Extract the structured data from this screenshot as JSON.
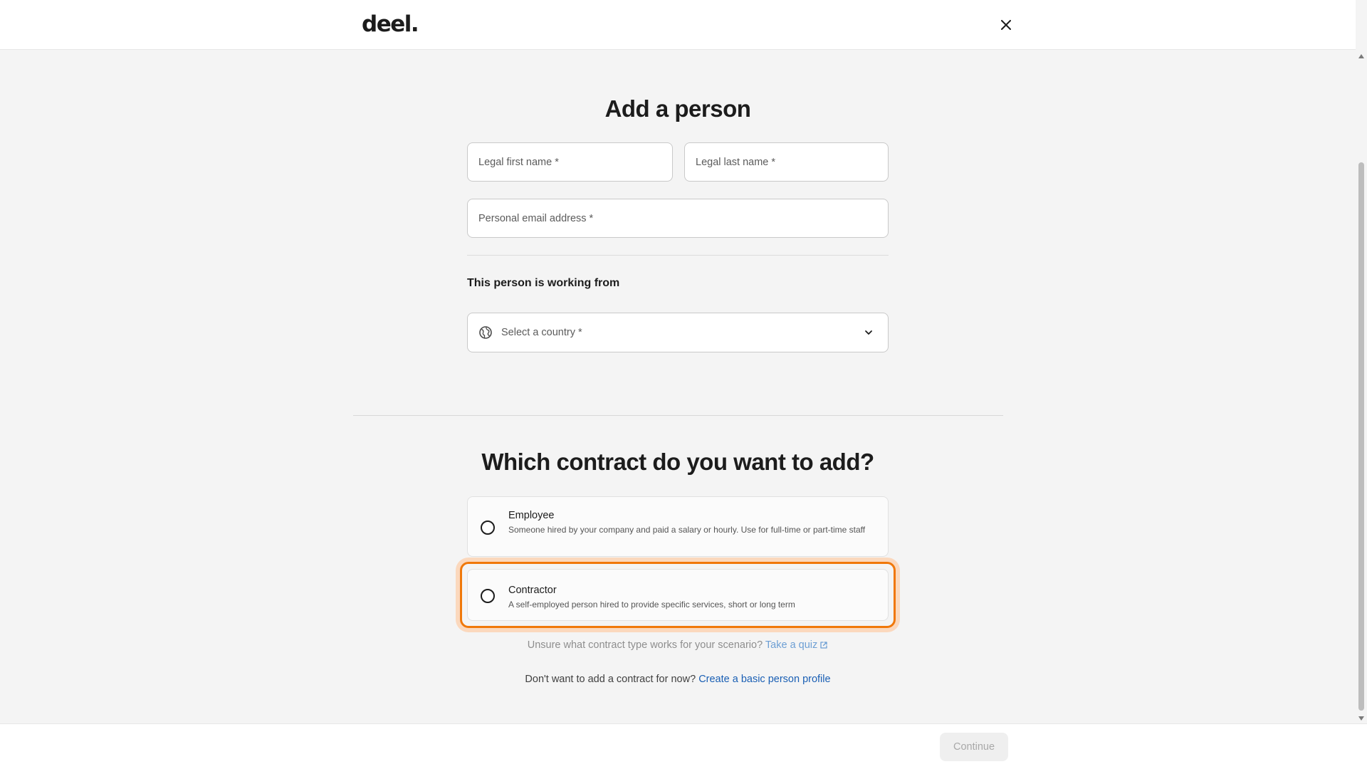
{
  "header": {
    "logo_text": "deel.",
    "close_icon": "close-icon"
  },
  "form": {
    "title": "Add a person",
    "first_name_placeholder": "Legal first name *",
    "last_name_placeholder": "Legal last name *",
    "email_placeholder": "Personal email address *",
    "working_from_label": "This person is working from",
    "country_placeholder": "Select a country *",
    "country_icon": "globe-icon",
    "dropdown_icon": "chevron-down-icon"
  },
  "contract": {
    "question": "Which contract do you want to add?",
    "options": [
      {
        "title": "Employee",
        "description": "Someone hired by your company and paid a salary or hourly. Use for full-time or part-time staff"
      },
      {
        "title": "Contractor",
        "description": "A self-employed person hired to provide specific services, short or long term"
      }
    ],
    "focused_option": "Contractor",
    "hint_text": "Unsure what contract type works for your scenario?",
    "quiz_link": "Take a quiz",
    "profile_text": "Don't want to add a contract for now?",
    "profile_link": "Create a basic person profile"
  },
  "footer": {
    "continue_label": "Continue"
  },
  "colors": {
    "focus_ring": "#f0780a",
    "link": "#1a5fb4",
    "background": "#f4f4f4"
  }
}
